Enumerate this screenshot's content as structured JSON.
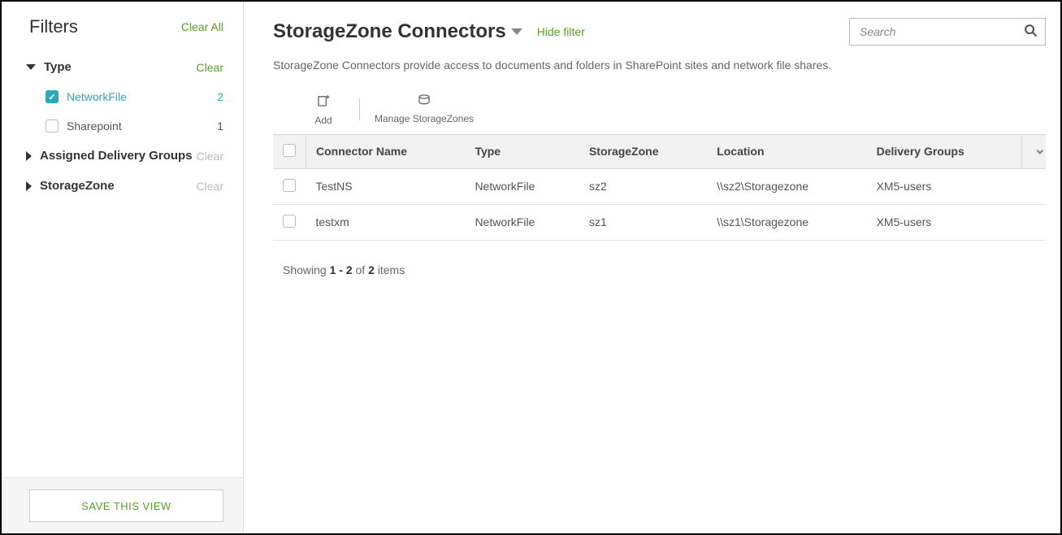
{
  "sidebar": {
    "title": "Filters",
    "clear_all": "Clear All",
    "groups": [
      {
        "label": "Type",
        "expanded": true,
        "clear_label": "Clear",
        "clear_enabled": true,
        "items": [
          {
            "label": "NetworkFile",
            "count": "2",
            "checked": true
          },
          {
            "label": "Sharepoint",
            "count": "1",
            "checked": false
          }
        ]
      },
      {
        "label": "Assigned Delivery Groups",
        "expanded": false,
        "clear_label": "Clear",
        "clear_enabled": false
      },
      {
        "label": "StorageZone",
        "expanded": false,
        "clear_label": "Clear",
        "clear_enabled": false
      }
    ],
    "save_view": "SAVE THIS VIEW"
  },
  "header": {
    "title": "StorageZone Connectors",
    "hide_filter": "Hide filter",
    "search_placeholder": "Search"
  },
  "description": "StorageZone Connectors provide access to documents and folders in SharePoint sites and network file shares.",
  "toolbar": {
    "add": "Add",
    "manage": "Manage StorageZones"
  },
  "table": {
    "columns": [
      "Connector Name",
      "Type",
      "StorageZone",
      "Location",
      "Delivery Groups"
    ],
    "rows": [
      {
        "name": "TestNS",
        "type": "NetworkFile",
        "zone": "sz2",
        "location": "\\\\sz2\\Storagezone",
        "groups": "XM5-users"
      },
      {
        "name": "testxm",
        "type": "NetworkFile",
        "zone": "sz1",
        "location": "\\\\sz1\\Storagezone",
        "groups": "XM5-users"
      }
    ]
  },
  "paging": {
    "prefix": "Showing ",
    "range": "1 - 2",
    "mid": " of ",
    "total": "2",
    "suffix": " items"
  }
}
